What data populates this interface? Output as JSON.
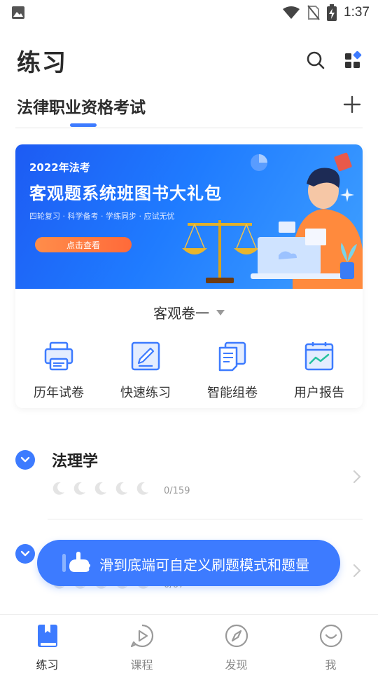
{
  "status_bar": {
    "time": "1:37",
    "icons": [
      "image-icon",
      "wifi-icon",
      "no-sim-icon",
      "battery-charging-icon"
    ]
  },
  "header": {
    "title": "练习",
    "icons": [
      "search-icon",
      "apps-icon"
    ]
  },
  "exam": {
    "name": "法律职业资格考试",
    "add_icon": "plus-icon"
  },
  "banner": {
    "tag": "2022年法考",
    "title": "客观题系统班图书大礼包",
    "subtitle": "四轮复习 · 科学备考 · 学练同步 · 应试无忧",
    "cta": "点击查看"
  },
  "paper_select": {
    "value": "客观卷一"
  },
  "tools": [
    {
      "label": "历年试卷",
      "icon": "printer-icon"
    },
    {
      "label": "快速练习",
      "icon": "edit-icon"
    },
    {
      "label": "智能组卷",
      "icon": "documents-icon"
    },
    {
      "label": "用户报告",
      "icon": "report-chart-icon"
    }
  ],
  "subjects": [
    {
      "name": "法理学",
      "progress": "0/159"
    },
    {
      "name": "",
      "progress": "0/67"
    }
  ],
  "toast": {
    "text": "滑到底端可自定义刷题模式和题量"
  },
  "bottom_nav": [
    {
      "label": "练习",
      "icon": "book-icon",
      "active": true
    },
    {
      "label": "课程",
      "icon": "play-circle-icon",
      "active": false
    },
    {
      "label": "发现",
      "icon": "compass-icon",
      "active": false
    },
    {
      "label": "我",
      "icon": "smile-icon",
      "active": false
    }
  ],
  "colors": {
    "accent": "#3d7bff",
    "text": "#222222",
    "muted": "#9a9a9a"
  }
}
